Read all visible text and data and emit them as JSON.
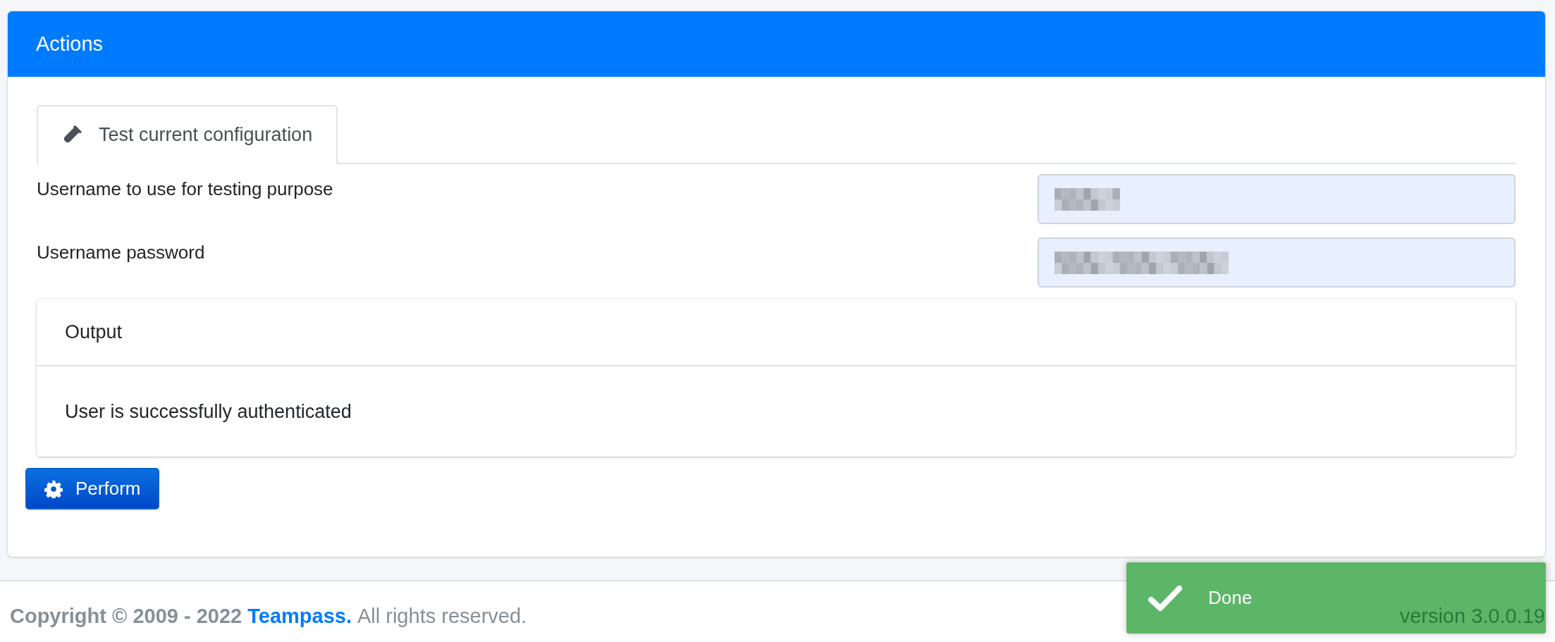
{
  "card": {
    "title": "Actions"
  },
  "tabs": [
    {
      "label": "Test current configuration",
      "selected": true
    }
  ],
  "form": {
    "fields": [
      {
        "label": "Username to use for testing purpose"
      },
      {
        "label": "Username password"
      }
    ]
  },
  "output": {
    "title": "Output",
    "message": "User is successfully authenticated"
  },
  "perform_button": {
    "label": "Perform"
  },
  "footer": {
    "copyright": "Copyright © 2009 - 2022",
    "brand": "Teampass.",
    "rights": "All rights reserved.",
    "version": "version 3.0.0.19"
  },
  "toast": {
    "message": "Done"
  }
}
